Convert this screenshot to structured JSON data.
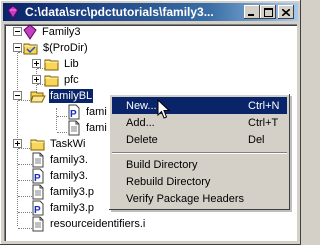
{
  "window": {
    "title": "C:\\data\\src\\pdctutorials\\family3...",
    "buttons": {
      "minimize": "minimize",
      "maximize": "maximize",
      "close": "close"
    }
  },
  "tree": {
    "items": [
      {
        "label": "Family3",
        "icon": "project-icon"
      },
      {
        "label": "$(ProDir)",
        "icon": "network-folder-icon"
      },
      {
        "label": "Lib",
        "icon": "folder-icon"
      },
      {
        "label": "pfc",
        "icon": "folder-icon"
      },
      {
        "label": "familyBL",
        "icon": "folder-open-icon"
      },
      {
        "label": "fami",
        "icon": "package-file-icon"
      },
      {
        "label": "fami",
        "icon": "file-icon"
      },
      {
        "label": "TaskWi",
        "icon": "folder-icon"
      },
      {
        "label": "family3.",
        "icon": "file-icon"
      },
      {
        "label": "family3.",
        "icon": "package-file-icon"
      },
      {
        "label": "family3.p",
        "icon": "file-icon"
      },
      {
        "label": "family3.p",
        "icon": "package-file-icon"
      },
      {
        "label": "resourceidentifiers.i",
        "icon": "file-icon"
      }
    ]
  },
  "context_menu": {
    "items": [
      {
        "label": "New...",
        "shortcut": "Ctrl+N"
      },
      {
        "label": "Add...",
        "shortcut": "Ctrl+T"
      },
      {
        "label": "Delete",
        "shortcut": "Del"
      },
      {
        "label": "Build Directory",
        "shortcut": ""
      },
      {
        "label": "Rebuild Directory",
        "shortcut": ""
      },
      {
        "label": "Verify Package Headers",
        "shortcut": ""
      }
    ]
  },
  "colors": {
    "titlebar": "#0a246a",
    "selection": "#0a246a",
    "face": "#d4d0c8",
    "folder": "#f7d65a"
  }
}
